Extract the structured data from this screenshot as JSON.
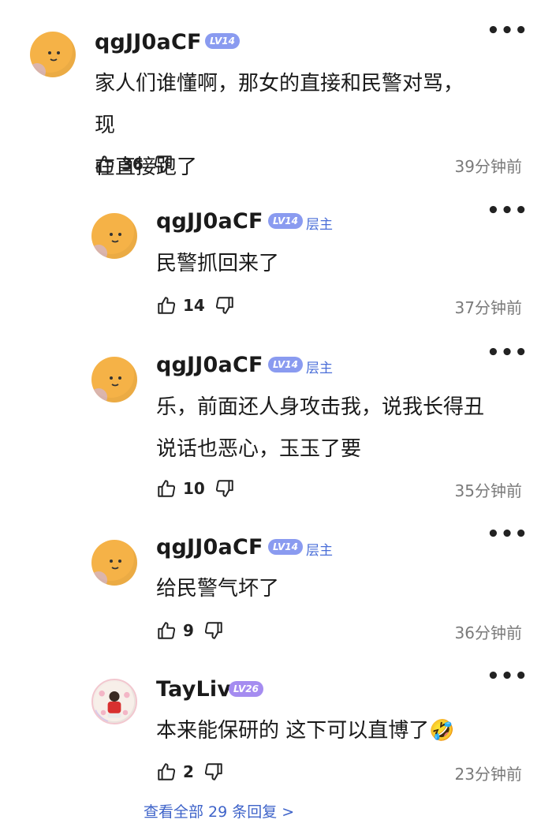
{
  "comments": [
    {
      "username": "qgJJ0aCF",
      "level": "LV14",
      "is_op": false,
      "text_lines": [
        "家人们谁懂啊，那女的直接和民警对骂，现",
        "在直接跑了"
      ],
      "likes": "36",
      "time": "39分钟前"
    },
    {
      "username": "qgJJ0aCF",
      "level": "LV14",
      "op_label": "层主",
      "text_lines": [
        "民警抓回来了"
      ],
      "likes": "14",
      "time": "37分钟前"
    },
    {
      "username": "qgJJ0aCF",
      "level": "LV14",
      "op_label": "层主",
      "text_lines": [
        "乐，前面还人身攻击我，说我长得丑",
        "说话也恶心，玉玉了要"
      ],
      "likes": "10",
      "time": "35分钟前"
    },
    {
      "username": "qgJJ0aCF",
      "level": "LV14",
      "op_label": "层主",
      "text_lines": [
        "给民警气坏了"
      ],
      "likes": "9",
      "time": "36分钟前"
    },
    {
      "username": "TayLiv",
      "level": "LV26",
      "text_lines": [
        "本来能保研的 这下可以直博了🤣"
      ],
      "likes": "2",
      "time": "23分钟前"
    }
  ],
  "more_glyph": "•••",
  "view_all": "查看全部 29 条回复 >",
  "colors": {
    "level_badge": "#8a9bf0",
    "level_badge_high": "#a58cf0",
    "op_tag": "#4a6ed8",
    "link": "#3e63c9",
    "avatar": "#f5b247"
  }
}
